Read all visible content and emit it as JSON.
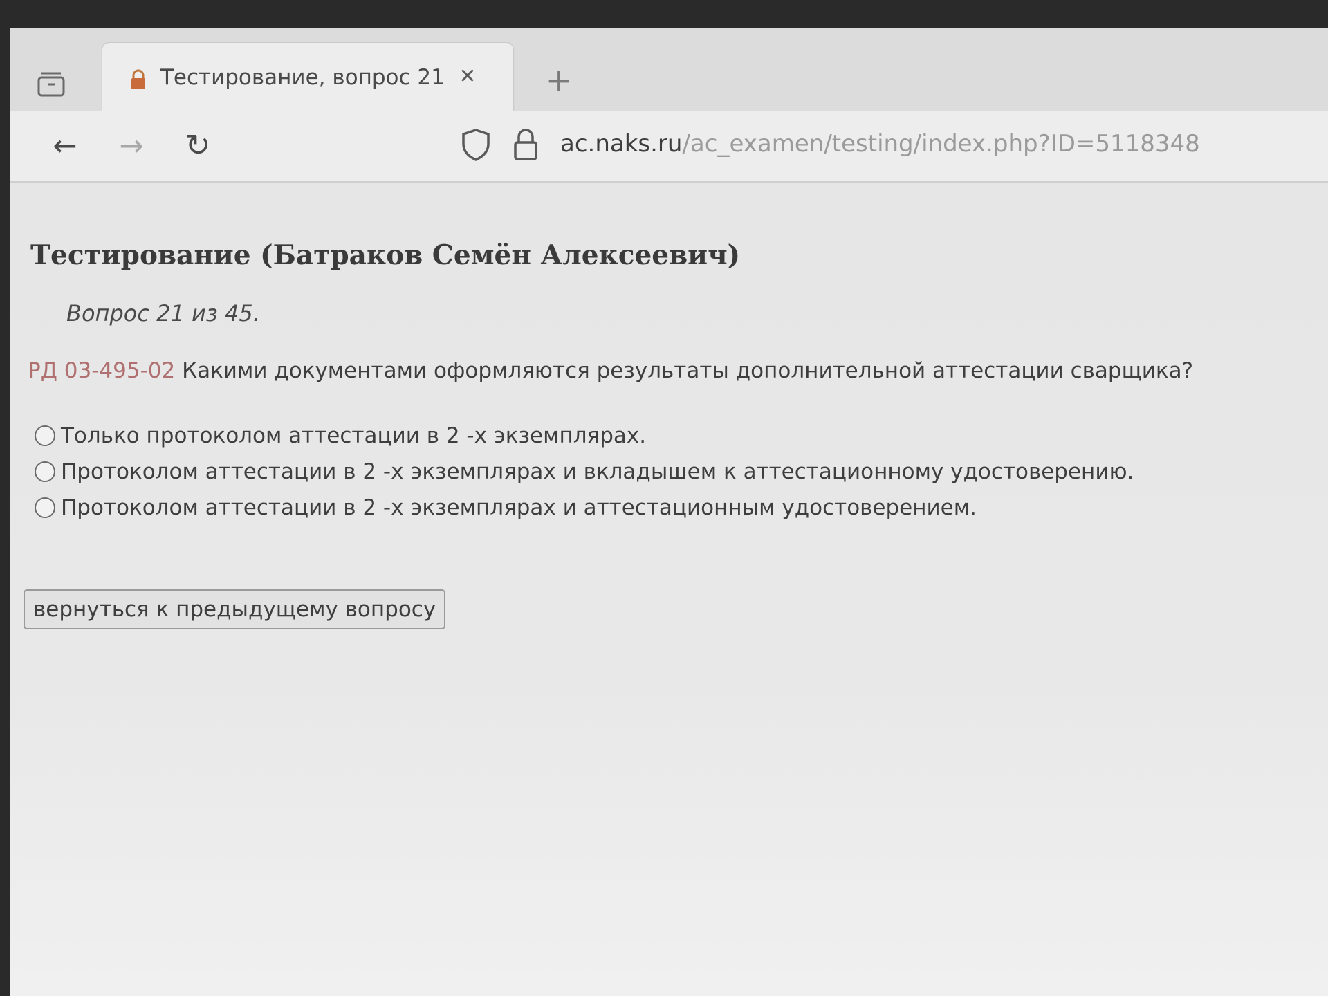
{
  "browser": {
    "tab": {
      "title": "Тестирование, вопрос 21",
      "close_glyph": "✕"
    },
    "new_tab_glyph": "+",
    "nav": {
      "back_glyph": "←",
      "forward_glyph": "→",
      "reload_glyph": "↻"
    },
    "url": {
      "host": "ac.naks.ru",
      "path": "/ac_examen/testing/index.php?ID=5118348"
    }
  },
  "page": {
    "title": "Тестирование (Батраков Семён Алексеевич)",
    "counter": "Вопрос 21 из 45.",
    "question": {
      "ref": "РД 03-495-02",
      "text": "Какими документами оформляются результаты дополнительной аттестации сварщика?"
    },
    "answers": [
      {
        "label": "Только протоколом аттестации в 2 -х экземплярах.",
        "selected": false
      },
      {
        "label": "Протоколом аттестации в 2 -х экземплярах и вкладышем к аттестационному удостоверению.",
        "selected": false
      },
      {
        "label": "Протоколом аттестации в 2 -х экземплярах и аттестационным удостоверением.",
        "selected": false
      }
    ],
    "back_button_label": "вернуться к предыдущему вопросу"
  },
  "colors": {
    "reference_text": "#b07070",
    "body_text": "#3e3e3e"
  }
}
